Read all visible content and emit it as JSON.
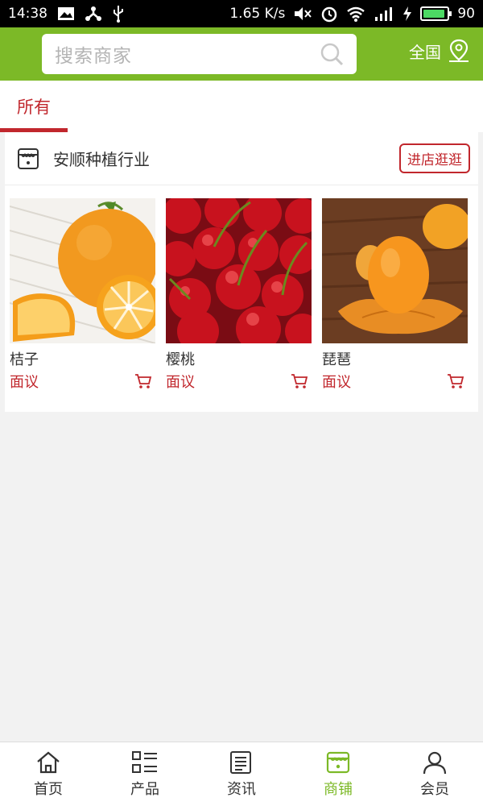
{
  "status_bar": {
    "time": "14:38",
    "speed": "1.65 K/s",
    "battery": "90",
    "battery_level": 0.9
  },
  "search": {
    "placeholder": "搜索商家"
  },
  "region": {
    "label": "全国"
  },
  "tabs": [
    {
      "label": "所有"
    }
  ],
  "shop": {
    "name": "安顺种植行业",
    "visit_label": "进店逛逛",
    "products": [
      {
        "name": "桔子",
        "price": "面议",
        "image": "orange"
      },
      {
        "name": "樱桃",
        "price": "面议",
        "image": "cherry"
      },
      {
        "name": "琵琶",
        "price": "面议",
        "image": "loquat"
      }
    ]
  },
  "bottom_nav": [
    {
      "label": "首页",
      "icon": "home-icon"
    },
    {
      "label": "产品",
      "icon": "grid-list-icon"
    },
    {
      "label": "资讯",
      "icon": "news-icon"
    },
    {
      "label": "商铺",
      "icon": "shop-icon",
      "active": true
    },
    {
      "label": "会员",
      "icon": "user-icon"
    }
  ],
  "colors": {
    "brand_green": "#7cb927",
    "accent_red": "#c1272d"
  }
}
